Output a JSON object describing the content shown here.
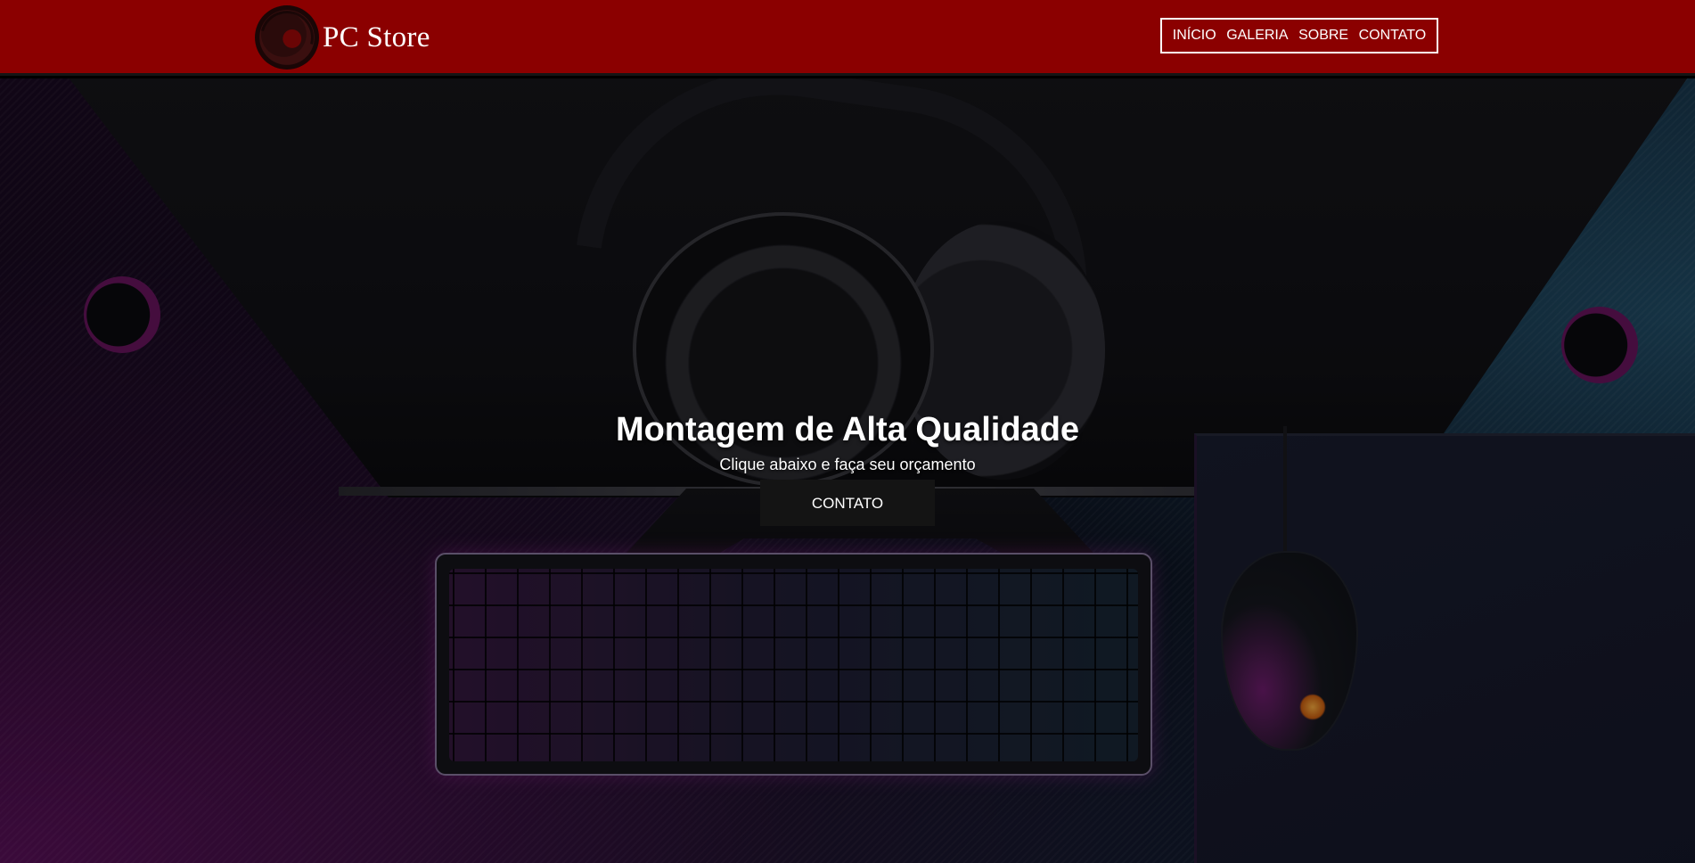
{
  "header": {
    "brand": "PC Store",
    "nav": [
      {
        "label": "INÍCIO"
      },
      {
        "label": "GALERIA"
      },
      {
        "label": "SOBRE"
      },
      {
        "label": "CONTATO"
      }
    ]
  },
  "hero": {
    "title": "Montagem de Alta Qualidade",
    "subtitle": "Clique abaixo e faça seu orçamento",
    "button_label": "CONTATO"
  },
  "colors": {
    "header_bg": "#8b0000",
    "button_bg": "#141414",
    "text": "#ffffff"
  }
}
